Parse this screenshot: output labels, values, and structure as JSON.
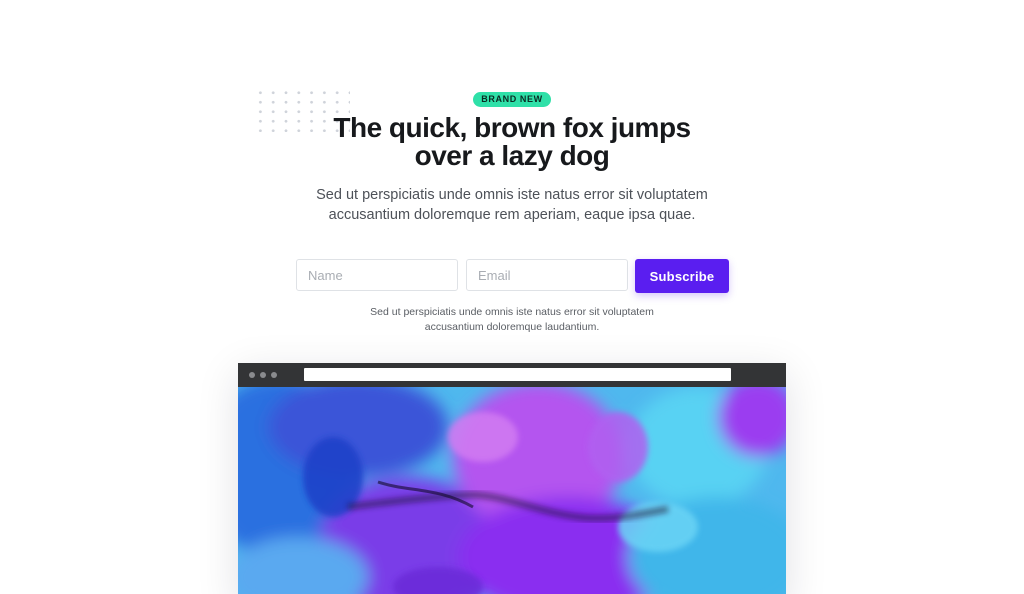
{
  "hero": {
    "badge": "BRAND NEW",
    "title_line1": "The quick, brown fox jumps",
    "title_line2": "over a lazy dog",
    "subtitle_line1": "Sed ut perspiciatis unde omnis iste natus error sit voluptatem",
    "subtitle_line2": "accusantium doloremque rem aperiam, eaque ipsa quae."
  },
  "form": {
    "name_placeholder": "Name",
    "email_placeholder": "Email",
    "subscribe_label": "Subscribe",
    "fineprint_line1": "Sed ut perspiciatis unde omnis iste natus error sit voluptatem",
    "fineprint_line2": "accusantium doloremque laudantium."
  },
  "colors": {
    "badge_bg": "#2fe0a8",
    "accent": "#5a1ef0",
    "browser_bar": "#333436"
  },
  "icons": {
    "decoration": "dot-grid",
    "window_controls": "traffic-dots"
  }
}
